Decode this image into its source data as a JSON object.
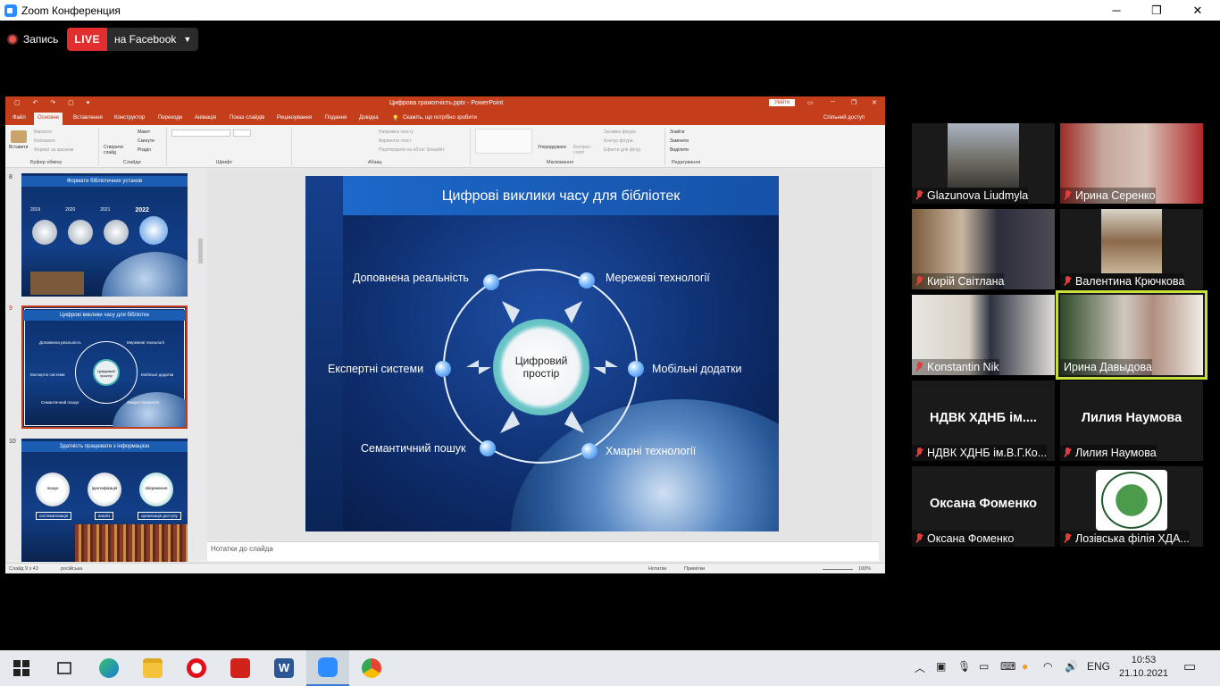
{
  "window": {
    "title": "Zoom Конференция",
    "minimize": "─",
    "maximize": "❐",
    "close": "✕"
  },
  "record": {
    "label": "Запись",
    "live": "LIVE",
    "platform": "на Facebook",
    "caret": "▼"
  },
  "ppt": {
    "filename": "Цифрова грамотність.pptx - PowerPoint",
    "signin": "Увійти",
    "qa": "▢ ↶ ↷ ▢ ▾",
    "tabs": [
      "Файл",
      "Основне",
      "Вставлення",
      "Конструктор",
      "Переходи",
      "Анімація",
      "Показ слайдів",
      "Рецензування",
      "Подання",
      "Довідка"
    ],
    "tellme": "Скажіть, що потрібно зробити",
    "share": "Спільний доступ",
    "ribbon": {
      "paste": "Вставити",
      "cut": "Вирізати",
      "copy": "Копіювати",
      "format_painter": "Формат за зразком",
      "new_slide": "Створити слайд",
      "layout": "Макет",
      "reset": "Скинути",
      "section": "Розділ",
      "text_direction": "Напрямок тексту",
      "align_text": "Вирівняти текст",
      "smartart": "Перетворити на об'єкт SmartArt",
      "arrange": "Упорядкувати",
      "quick_styles": "Експрес-стилі",
      "shape_fill": "Заливка фігури",
      "shape_outline": "Контур фігури",
      "shape_effects": "Ефекти для фігур",
      "find": "Знайти",
      "replace": "Замінити",
      "select": "Виділити",
      "groups": [
        "Буфер обміну",
        "Слайди",
        "Шрифт",
        "Абзац",
        "Малювання",
        "Редагування"
      ]
    },
    "thumbs": [
      {
        "num": "8",
        "title": "Формати бібліотечних установ",
        "years": [
          "2019",
          "2020",
          "2021",
          "2022"
        ]
      },
      {
        "num": "9",
        "title": "Цифрові виклики часу для бібліотек",
        "center": "Цифровий простір",
        "labels": [
          "Доповнена реальність",
          "Мережеві технології",
          "Експертні системи",
          "Мобільні додатки",
          "Семантичний пошук",
          "Хмарні технології"
        ]
      },
      {
        "num": "10",
        "title": "Здатність працювати з інформацією",
        "circles": [
          "пошук",
          "ідентифікація",
          "збереження"
        ],
        "tags": [
          "систематизація",
          "аналіз",
          "організація доступу"
        ]
      }
    ],
    "slide": {
      "title": "Цифрові виклики часу для бібліотек",
      "center": "Цифровий простір",
      "nodes": [
        "Доповнена реальність",
        "Мережеві технології",
        "Експертні системи",
        "Мобільні додатки",
        "Семантичний пошук",
        "Хмарні технології"
      ]
    },
    "notes": "Нотатки до слайда",
    "status": {
      "slide": "Слайд 9 з 43",
      "lang": "російська",
      "notes": "Нотатки",
      "comments": "Примітки",
      "zoom": "100%"
    }
  },
  "participants": [
    {
      "name": "Glazunova Liudmyla",
      "type": "video"
    },
    {
      "name": "Ирина Серенко",
      "type": "video"
    },
    {
      "name": "Кирій Світлана",
      "type": "video"
    },
    {
      "name": "Валентина Крючкова",
      "type": "video"
    },
    {
      "name": "Konstantin Nik",
      "type": "video"
    },
    {
      "name": "Ирина Давыдова",
      "type": "video",
      "active": true
    },
    {
      "name": "НДВК ХДНБ ім.В.Г.Ко...",
      "big": "НДВК ХДНБ ім....",
      "type": "name"
    },
    {
      "name": "Лилия Наумова",
      "big": "Лилия Наумова",
      "type": "name"
    },
    {
      "name": "Оксана Фоменко",
      "big": "Оксана Фоменко",
      "type": "name"
    },
    {
      "name": "Лозівська філія ХДА...",
      "type": "logo"
    }
  ],
  "taskbar": {
    "lang": "ENG",
    "time": "10:53",
    "date": "21.10.2021"
  }
}
